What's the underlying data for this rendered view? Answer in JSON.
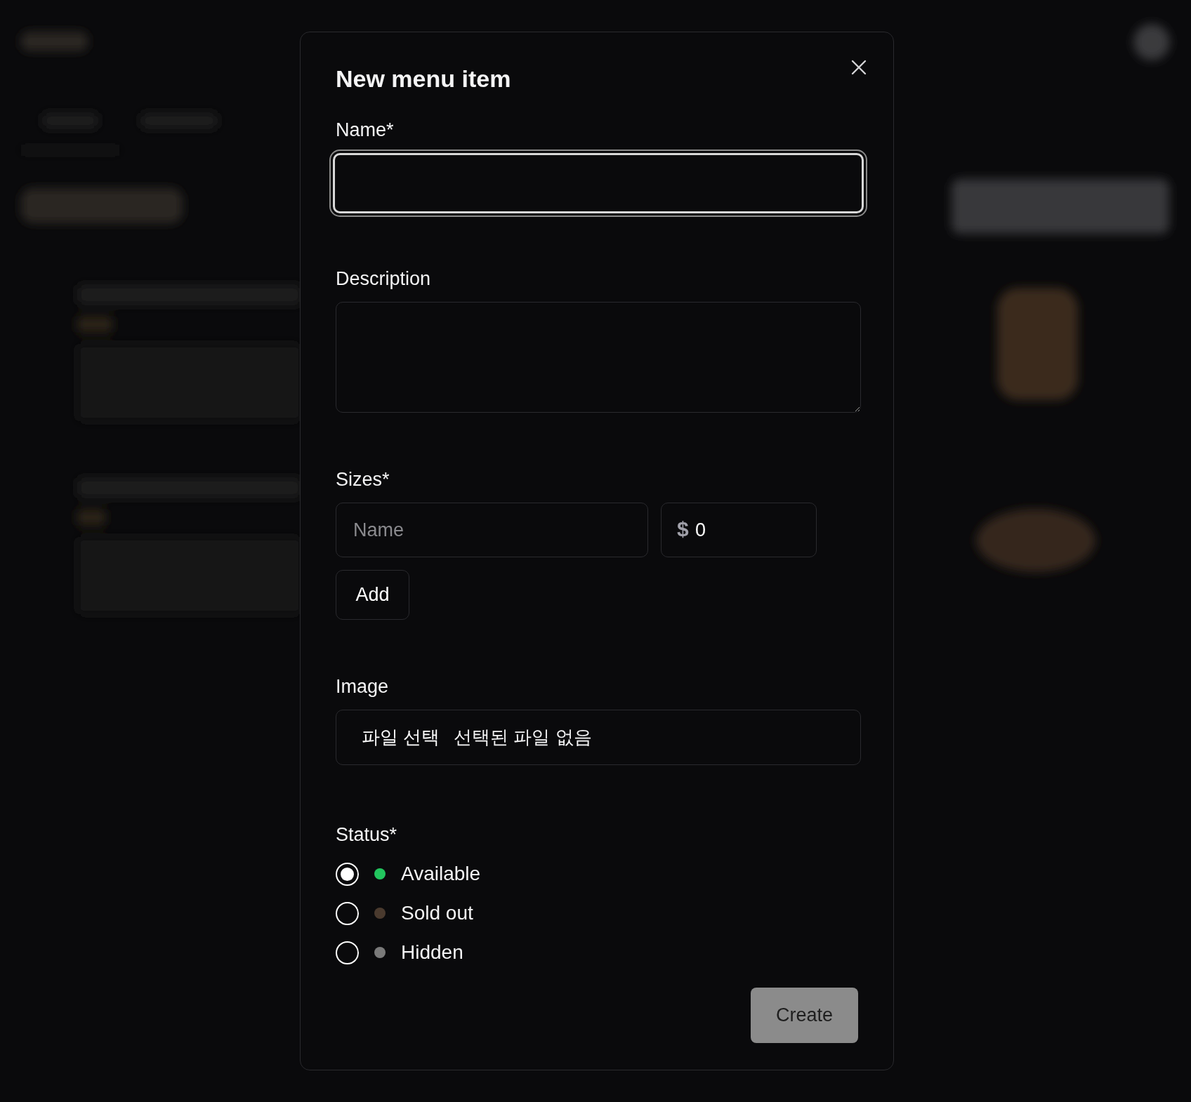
{
  "dialog": {
    "title": "New menu item"
  },
  "name_field": {
    "label": "Name*",
    "focused": true
  },
  "description_field": {
    "label": "Description"
  },
  "sizes": {
    "label": "Sizes*",
    "name_placeholder": "Name",
    "price_prefix": "$",
    "price_value": "0",
    "add_button": "Add"
  },
  "image": {
    "label": "Image",
    "button": "파일 선택",
    "status": "선택된 파일 없음"
  },
  "status": {
    "label": "Status*",
    "options": [
      {
        "label": "Available",
        "selected": true,
        "color": "#22c55e"
      },
      {
        "label": "Sold out",
        "selected": false,
        "color": "#4a3a2e"
      },
      {
        "label": "Hidden",
        "selected": false,
        "color": "#7a7a7a"
      }
    ]
  },
  "create_button": {
    "label": "Create",
    "disabled": true
  }
}
